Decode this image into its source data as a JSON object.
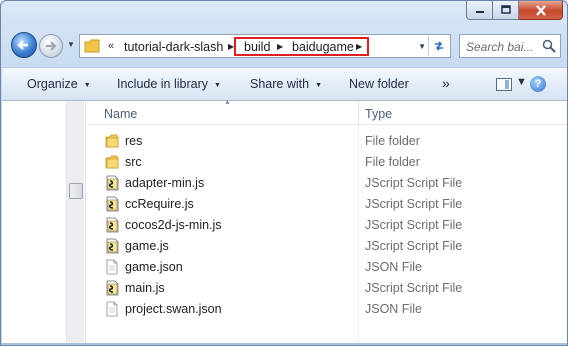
{
  "navigation": {
    "breadcrumb_overflow": "«",
    "crumbs": [
      "tutorial-dark-slash",
      "build",
      "baidugame"
    ]
  },
  "search": {
    "placeholder": "Search bai..."
  },
  "toolbar": {
    "organize": "Organize",
    "include_in_library": "Include in library",
    "share_with": "Share with",
    "new_folder": "New folder"
  },
  "columns": {
    "name": "Name",
    "type": "Type"
  },
  "files": [
    {
      "name": "res",
      "type": "File folder",
      "icon": "folder-icon"
    },
    {
      "name": "src",
      "type": "File folder",
      "icon": "folder-icon"
    },
    {
      "name": "adapter-min.js",
      "type": "JScript Script File",
      "icon": "jscript-file-icon"
    },
    {
      "name": "ccRequire.js",
      "type": "JScript Script File",
      "icon": "jscript-file-icon"
    },
    {
      "name": "cocos2d-js-min.js",
      "type": "JScript Script File",
      "icon": "jscript-file-icon"
    },
    {
      "name": "game.js",
      "type": "JScript Script File",
      "icon": "jscript-file-icon"
    },
    {
      "name": "game.json",
      "type": "JSON File",
      "icon": "json-file-icon"
    },
    {
      "name": "main.js",
      "type": "JScript Script File",
      "icon": "jscript-file-icon"
    },
    {
      "name": "project.swan.json",
      "type": "JSON File",
      "icon": "json-file-icon"
    }
  ],
  "colors": {
    "highlight": "#e02020",
    "type_text": "#6d6d6d",
    "header_text": "#4c607a"
  }
}
